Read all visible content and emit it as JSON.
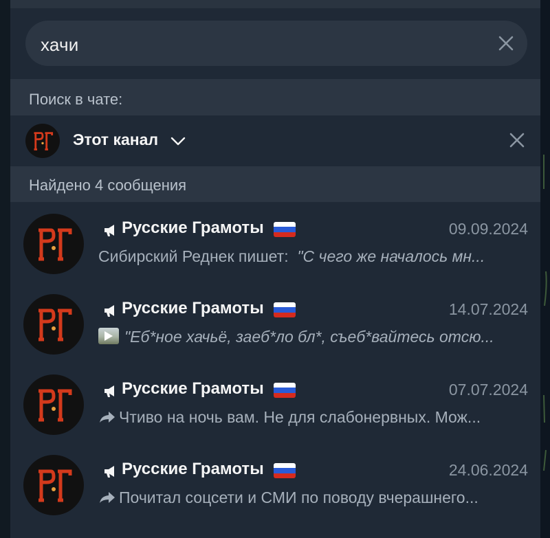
{
  "search": {
    "query": "хачи"
  },
  "labels": {
    "search_in_chat": "Поиск в чате:",
    "scope_name": "Этот канал",
    "found_count": "Найдено 4 сообщения"
  },
  "colors": {
    "panel": "#1f2936",
    "section": "#2c3643",
    "avatar_bg": "#111111",
    "logo_red": "#d43a1c"
  },
  "results": [
    {
      "channel": "Русские Грамоты",
      "date": "09.09.2024",
      "prefix_icon": "none",
      "sender": "Сибирский Реднек пишет:",
      "text": "\"С чего же началось мн..."
    },
    {
      "channel": "Русские Грамоты",
      "date": "14.07.2024",
      "prefix_icon": "video-thumbnail-icon",
      "sender": "",
      "text": "\"Еб*ное хачьё, заеб*ло бл*, съеб*вайтесь отсю..."
    },
    {
      "channel": "Русские Грамоты",
      "date": "07.07.2024",
      "prefix_icon": "forward-icon",
      "sender": "",
      "text": "Чтиво на ночь вам. Не для слабонервных. Мож..."
    },
    {
      "channel": "Русские Грамоты",
      "date": "24.06.2024",
      "prefix_icon": "forward-icon",
      "sender": "",
      "text": "Почитал соцсети и СМИ по поводу вчерашнего..."
    }
  ]
}
